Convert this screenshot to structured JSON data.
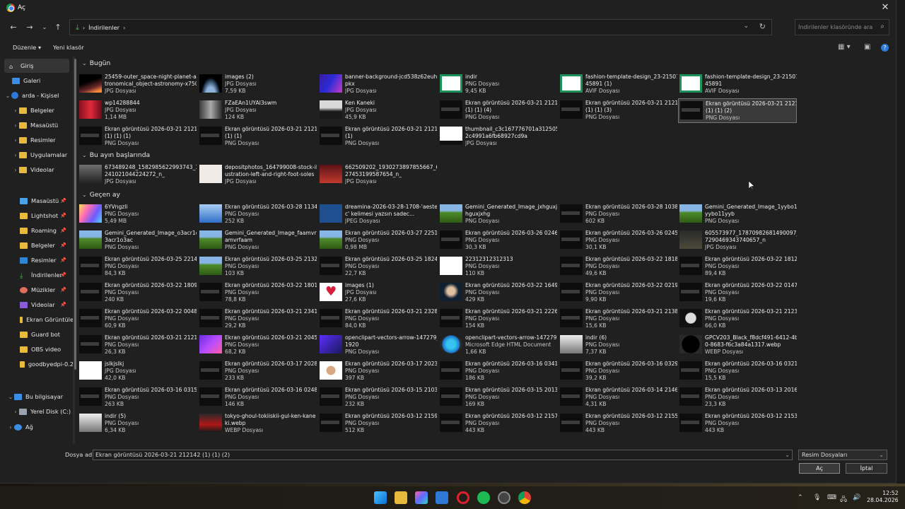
{
  "window": {
    "title": "Aç"
  },
  "nav": {
    "path": "İndirilenler",
    "search_placeholder": "İndirilenler klasöründe ara"
  },
  "commands": {
    "organize": "Düzenle",
    "new_folder": "Yeni klasör"
  },
  "sidebar": {
    "items": [
      {
        "label": "Giriş"
      },
      {
        "label": "Galeri"
      },
      {
        "label": "arda - Kişisel"
      },
      {
        "label": "Belgeler"
      },
      {
        "label": "Masaüstü"
      },
      {
        "label": "Resimler"
      },
      {
        "label": "Uygulamalar"
      },
      {
        "label": "Videolar"
      },
      {
        "label": "Masaüstü"
      },
      {
        "label": "Lightshot"
      },
      {
        "label": "Roaming"
      },
      {
        "label": "Belgeler"
      },
      {
        "label": "Resimler"
      },
      {
        "label": "İndirilenler"
      },
      {
        "label": "Müzikler"
      },
      {
        "label": "Videolar"
      },
      {
        "label": "Ekran Görüntüle"
      },
      {
        "label": "Guard bot"
      },
      {
        "label": "OBS video"
      },
      {
        "label": "goodbyedpi-0.2"
      },
      {
        "label": "Bu bilgisayar"
      },
      {
        "label": "Yerel Disk (C:)"
      },
      {
        "label": "Ağ"
      }
    ]
  },
  "groups": {
    "today": "Bugün",
    "early_month": "Bu ayın başlarında",
    "last_month": "Geçen ay"
  },
  "files": {
    "today": [
      {
        "name": "25459-outer_space-night-planet-as",
        "name2": "tronomical_object-astronomy-x750",
        "meta": "JPG Dosyası"
      },
      {
        "name": "images (2)",
        "meta": "JPG Dosyası",
        "meta2": "7,59 KB"
      },
      {
        "name": "banner-background-jcd538z62euhf",
        "name2": "pkx",
        "meta": "JPG Dosyası"
      },
      {
        "name": "indir",
        "meta": "PNG Dosyası",
        "meta2": "9,45 KB"
      },
      {
        "name": "fashion-template-design_23-21507",
        "name2": "45891 (1)",
        "meta": "AVIF Dosyası"
      },
      {
        "name": "fashion-template-design_23-21507",
        "name2": "45891",
        "meta": "AVIF Dosyası"
      },
      {
        "name": "wp14288844",
        "meta": "JPG Dosyası",
        "meta2": "1,14 MB"
      },
      {
        "name": "FZaEAn1UYAI3swm",
        "meta": "JPG Dosyası",
        "meta2": "124 KB"
      },
      {
        "name": "Ken Kaneki",
        "meta": "JPG Dosyası",
        "meta2": "45,9 KB"
      },
      {
        "name": "Ekran görüntüsü 2026-03-21 212142",
        "name2": "(1) (1) (4)",
        "meta": "PNG Dosyası"
      },
      {
        "name": "Ekran görüntüsü 2026-03-21 212142",
        "name2": "(1) (1) (3)",
        "meta": "PNG Dosyası"
      },
      {
        "name": "Ekran görüntüsü 2026-03-21 212142",
        "name2": "(1) (1) (2)",
        "meta": "PNG Dosyası"
      },
      {
        "name": "Ekran görüntüsü 2026-03-21 212142",
        "name2": "(1) (1) (1)",
        "meta": "PNG Dosyası"
      },
      {
        "name": "Ekran görüntüsü 2026-03-21 212142",
        "name2": "(1) (1)",
        "meta": "PNG Dosyası"
      },
      {
        "name": "Ekran görüntüsü 2026-03-21 212142",
        "name2": "(1)",
        "meta": "PNG Dosyası"
      },
      {
        "name": "thumbnail_c3c167776701a312505",
        "name2": "2c4991a6fb68927cd9a",
        "meta": "JPG Dosyası"
      }
    ],
    "early_month": [
      {
        "name": "673489248_1582985622993743_3118",
        "name2": "241021044224272_n_",
        "meta": "JPG Dosyası"
      },
      {
        "name": "depositphotos_164799008-stock-ill",
        "name2": "ustration-left-and-right-foot-soles",
        "meta": "JPG Dosyası"
      },
      {
        "name": "662509202_1930273897855667_6886",
        "name2": "27453199587654_n_",
        "meta": "JPG Dosyası"
      }
    ],
    "last_month": [
      {
        "name": "6YVngzli",
        "meta": "PNG Dosyası",
        "meta2": "5,49 MB"
      },
      {
        "name": "Ekran görüntüsü 2026-03-28 113453",
        "meta": "PNG Dosyası",
        "meta2": "252 KB"
      },
      {
        "name": "dreamina-2026-03-28-1708-'aesteti",
        "name2": "c' kelimesi yazsın sadec...",
        "meta": "JPEG Dosyası"
      },
      {
        "name": "Gemini_Generated_Image_jxhguxjx",
        "name2": "hguxjxhg",
        "meta": "PNG Dosyası"
      },
      {
        "name": "Ekran görüntüsü 2026-03-28 103800",
        "meta": "PNG Dosyası",
        "meta2": "602 KB"
      },
      {
        "name": "Gemini_Generated_Image_1yybo11",
        "name2": "yybo11yyb",
        "meta": "PNG Dosyası"
      },
      {
        "name": "Gemini_Generated_Image_o3acr1o",
        "name2": "3acr1o3ac",
        "meta": "PNG Dosyası"
      },
      {
        "name": "Gemini_Generated_Image_faamvrfa",
        "name2": "amvrfaam",
        "meta": "PNG Dosyası"
      },
      {
        "name": "Ekran görüntüsü 2026-03-27 225123",
        "meta": "PNG Dosyası",
        "meta2": "0,98 MB"
      },
      {
        "name": "Ekran görüntüsü 2026-03-26 024639",
        "meta": "PNG Dosyası",
        "meta2": "30,3 KB"
      },
      {
        "name": "Ekran görüntüsü 2026-03-26 024507",
        "meta": "PNG Dosyası",
        "meta2": "30,1 KB"
      },
      {
        "name": "605573977_17870982681490097_278",
        "name2": "7290469343740657_n",
        "meta": "JPG Dosyası"
      },
      {
        "name": "Ekran görüntüsü 2026-03-25 221457",
        "meta": "PNG Dosyası",
        "meta2": "84,3 KB"
      },
      {
        "name": "Ekran görüntüsü 2026-03-25 213230",
        "meta": "PNG Dosyası",
        "meta2": "103 KB"
      },
      {
        "name": "Ekran görüntüsü 2026-03-25 182439",
        "meta": "PNG Dosyası",
        "meta2": "22,7 KB"
      },
      {
        "name": "22312312312313",
        "meta": "PNG Dosyası",
        "meta2": "110 KB"
      },
      {
        "name": "Ekran görüntüsü 2026-03-22 181843",
        "meta": "PNG Dosyası",
        "meta2": "49,6 KB"
      },
      {
        "name": "Ekran görüntüsü 2026-03-22 181202",
        "meta": "PNG Dosyası",
        "meta2": "89,4 KB"
      },
      {
        "name": "Ekran görüntüsü 2026-03-22 180927",
        "meta": "PNG Dosyası",
        "meta2": "240 KB"
      },
      {
        "name": "Ekran görüntüsü 2026-03-22 180118",
        "meta": "PNG Dosyası",
        "meta2": "78,8 KB"
      },
      {
        "name": "images (1)",
        "meta": "JPG Dosyası",
        "meta2": "27,6 KB"
      },
      {
        "name": "Ekran görüntüsü 2026-03-22 164959",
        "meta": "PNG Dosyası",
        "meta2": "429 KB"
      },
      {
        "name": "Ekran görüntüsü 2026-03-22 021915",
        "meta": "PNG Dosyası",
        "meta2": "9,90 KB"
      },
      {
        "name": "Ekran görüntüsü 2026-03-22 014703",
        "meta": "PNG Dosyası",
        "meta2": "19,6 KB"
      },
      {
        "name": "Ekran görüntüsü 2026-03-22 004854",
        "meta": "PNG Dosyası",
        "meta2": "60,9 KB"
      },
      {
        "name": "Ekran görüntüsü 2026-03-21 234159",
        "meta": "PNG Dosyası",
        "meta2": "29,2 KB"
      },
      {
        "name": "Ekran görüntüsü 2026-03-21 232833",
        "meta": "PNG Dosyası",
        "meta2": "84,0 KB"
      },
      {
        "name": "Ekran görüntüsü 2026-03-21 222657",
        "meta": "PNG Dosyası",
        "meta2": "154 KB"
      },
      {
        "name": "Ekran görüntüsü 2026-03-21 213814",
        "meta": "PNG Dosyası",
        "meta2": "15,6 KB"
      },
      {
        "name": "Ekran görüntüsü 2026-03-21 212300",
        "meta": "PNG Dosyası",
        "meta2": "66,0 KB"
      },
      {
        "name": "Ekran görüntüsü 2026-03-21 212142",
        "meta": "PNG Dosyası",
        "meta2": "26,3 KB"
      },
      {
        "name": "Ekran görüntüsü 2026-03-21 204529",
        "meta": "PNG Dosyası",
        "meta2": "68,2 KB"
      },
      {
        "name": "openclipart-vectors-arrow-147279_",
        "name2": "1920",
        "meta": "PNG Dosyası"
      },
      {
        "name": "openclipart-vectors-arrow-147279",
        "meta": "Microsoft Edge HTML Document",
        "meta2": "1,66 KB"
      },
      {
        "name": "indir (6)",
        "meta": "PNG Dosyası",
        "meta2": "7,37 KB"
      },
      {
        "name": "GPCV203_Black_f8dcf491-6412-4bc",
        "name2": "0-8683-f6c3a84a1317.webp",
        "meta": "WEBP Dosyası"
      },
      {
        "name": "jslkjslkj",
        "meta": "JPG Dosyası",
        "meta2": "42,0 KB"
      },
      {
        "name": "Ekran görüntüsü 2026-03-17 202836",
        "meta": "PNG Dosyası",
        "meta2": "233 KB"
      },
      {
        "name": "Ekran görüntüsü 2026-03-17 202347",
        "meta": "PNG Dosyası",
        "meta2": "397 KB"
      },
      {
        "name": "Ekran görüntüsü 2026-03-16 034150",
        "meta": "PNG Dosyası",
        "meta2": "186 KB"
      },
      {
        "name": "Ekran görüntüsü 2026-03-16 032928",
        "meta": "PNG Dosyası",
        "meta2": "39,2 KB"
      },
      {
        "name": "Ekran görüntüsü 2026-03-16 032105",
        "meta": "PNG Dosyası",
        "meta2": "15,5 KB"
      },
      {
        "name": "Ekran görüntüsü 2026-03-16 031514",
        "meta": "PNG Dosyası",
        "meta2": "263 KB"
      },
      {
        "name": "Ekran görüntüsü 2026-03-16 024844",
        "meta": "PNG Dosyası",
        "meta2": "146 KB"
      },
      {
        "name": "Ekran görüntüsü 2026-03-15 210335",
        "meta": "PNG Dosyası",
        "meta2": "232 KB"
      },
      {
        "name": "Ekran görüntüsü 2026-03-15 201301",
        "meta": "PNG Dosyası",
        "meta2": "169 KB"
      },
      {
        "name": "Ekran görüntüsü 2026-03-14 214648",
        "meta": "PNG Dosyası",
        "meta2": "4,31 KB"
      },
      {
        "name": "Ekran görüntüsü 2026-03-13 201632",
        "meta": "PNG Dosyası",
        "meta2": "23,3 KB"
      },
      {
        "name": "indir (5)",
        "meta": "PNG Dosyası",
        "meta2": "6,34 KB"
      },
      {
        "name": "tokyo-ghoul-tokiiskii-gul-ken-kane",
        "name2": "ki.webp",
        "meta": "WEBP Dosyası"
      },
      {
        "name": "Ekran görüntüsü 2026-03-12 215958",
        "meta": "PNG Dosyası",
        "meta2": "512 KB"
      },
      {
        "name": "Ekran görüntüsü 2026-03-12 215724",
        "meta": "PNG Dosyası",
        "meta2": "443 KB"
      },
      {
        "name": "Ekran görüntüsü 2026-03-12 215537",
        "meta": "PNG Dosyası",
        "meta2": "443 KB"
      },
      {
        "name": "Ekran görüntüsü 2026-03-12 215331",
        "meta": "PNG Dosyası",
        "meta2": "443 KB"
      }
    ]
  },
  "bottom": {
    "filename_label": "Dosya adı:",
    "filename_value": "Ekran görüntüsü 2026-03-21 212142 (1) (1) (2)",
    "filetype": "Resim Dosyaları",
    "open": "Aç",
    "cancel": "İptal"
  },
  "clock": {
    "time": "12:52",
    "date": "28.04.2026"
  },
  "colors": {
    "accent": "#2d7ad6",
    "download_green": "#4caf50",
    "dialog_bg": "#202020"
  }
}
